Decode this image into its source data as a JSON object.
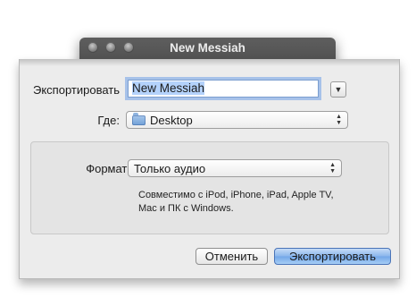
{
  "window": {
    "title": "New Messiah"
  },
  "sheet": {
    "export_label": "Экспортировать",
    "export_name_value": "New Messiah",
    "where_label": "Где:",
    "where_value": "Desktop",
    "format_label": "Формат:",
    "format_value": "Только аудио",
    "format_description_line1": "Совместимо с iPod, iPhone, iPad, Apple TV,",
    "format_description_line2": "Mac и ПК с Windows.",
    "cancel_label": "Отменить",
    "export_button_label": "Экспортировать"
  },
  "icons": {
    "folder": "folder-icon",
    "disclosure": "chevron-down-icon",
    "popup_arrows": "up-down-arrows-icon"
  },
  "colors": {
    "default_button": "#8ab6ec",
    "focus_ring": "#70a0e8",
    "text_selection": "#b4d2fb"
  }
}
